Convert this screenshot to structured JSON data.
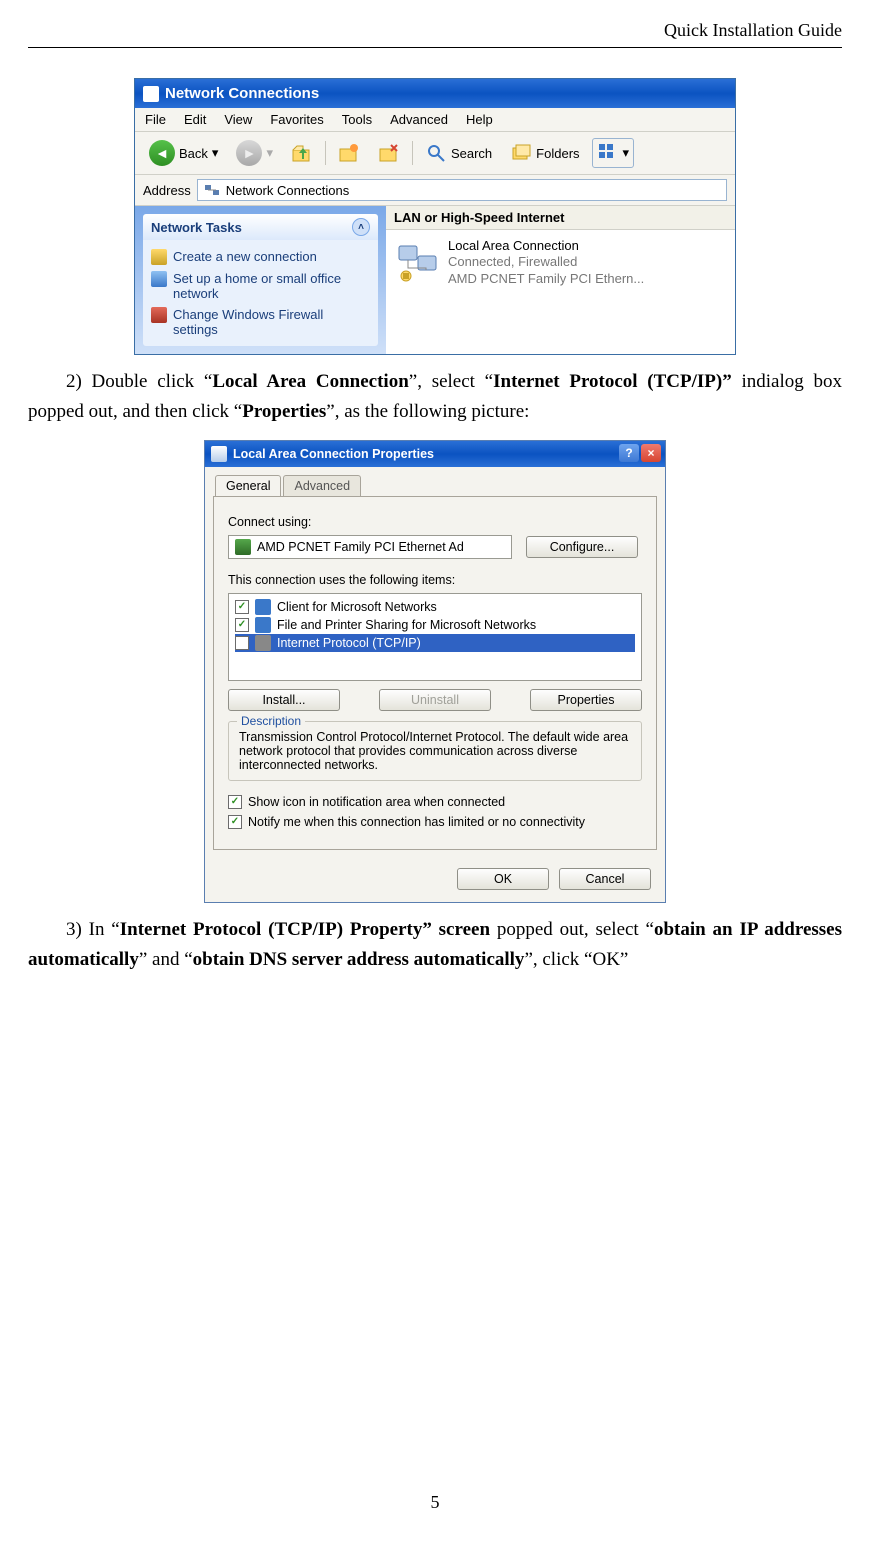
{
  "header": {
    "right": "Quick Installation Guide"
  },
  "page_number": "5",
  "fig1": {
    "title": "Network Connections",
    "menu": [
      "File",
      "Edit",
      "View",
      "Favorites",
      "Tools",
      "Advanced",
      "Help"
    ],
    "toolbar": {
      "back": "Back",
      "search": "Search",
      "folders": "Folders"
    },
    "address_label": "Address",
    "address_value": "Network Connections",
    "side_title": "Network Tasks",
    "side_items": [
      "Create a new connection",
      "Set up a home or small office network",
      "Change Windows Firewall settings"
    ],
    "category": "LAN or High-Speed Internet",
    "conn_name": "Local Area Connection",
    "conn_status": "Connected, Firewalled",
    "conn_device": "AMD PCNET Family PCI Ethern..."
  },
  "para2": {
    "pre": "2) Double click “",
    "b1": "Local Area Connection",
    "mid1": "”, select “",
    "b2": "Internet Protocol (TCP/IP)” ",
    "mid2": "indialog box popped out, and then click “",
    "b3": "Properties",
    "post": "”, as the following picture:"
  },
  "fig2": {
    "title": "Local Area Connection Properties",
    "tab_general": "General",
    "tab_advanced": "Advanced",
    "connect_using": "Connect using:",
    "adapter": "AMD PCNET Family PCI Ethernet Ad",
    "configure": "Configure...",
    "uses_label": "This connection uses the following items:",
    "items": [
      "Client for Microsoft Networks",
      "File and Printer Sharing for Microsoft Networks",
      "Internet Protocol (TCP/IP)"
    ],
    "install": "Install...",
    "uninstall": "Uninstall",
    "properties": "Properties",
    "desc_title": "Description",
    "desc_body": "Transmission Control Protocol/Internet Protocol. The default wide area network protocol that provides communication across diverse interconnected networks.",
    "check1": "Show icon in notification area when connected",
    "check2": "Notify me when this connection has limited or no connectivity",
    "ok": "OK",
    "cancel": "Cancel"
  },
  "para3": {
    "pre": "3) In “",
    "b1": "Internet Protocol (TCP/IP) Property” screen",
    "mid1": " popped out, select “",
    "b2": "obtain an IP addresses automatically",
    "mid2": "” and “",
    "b3": "obtain DNS server address automatically",
    "post": "”, click “OK”"
  }
}
